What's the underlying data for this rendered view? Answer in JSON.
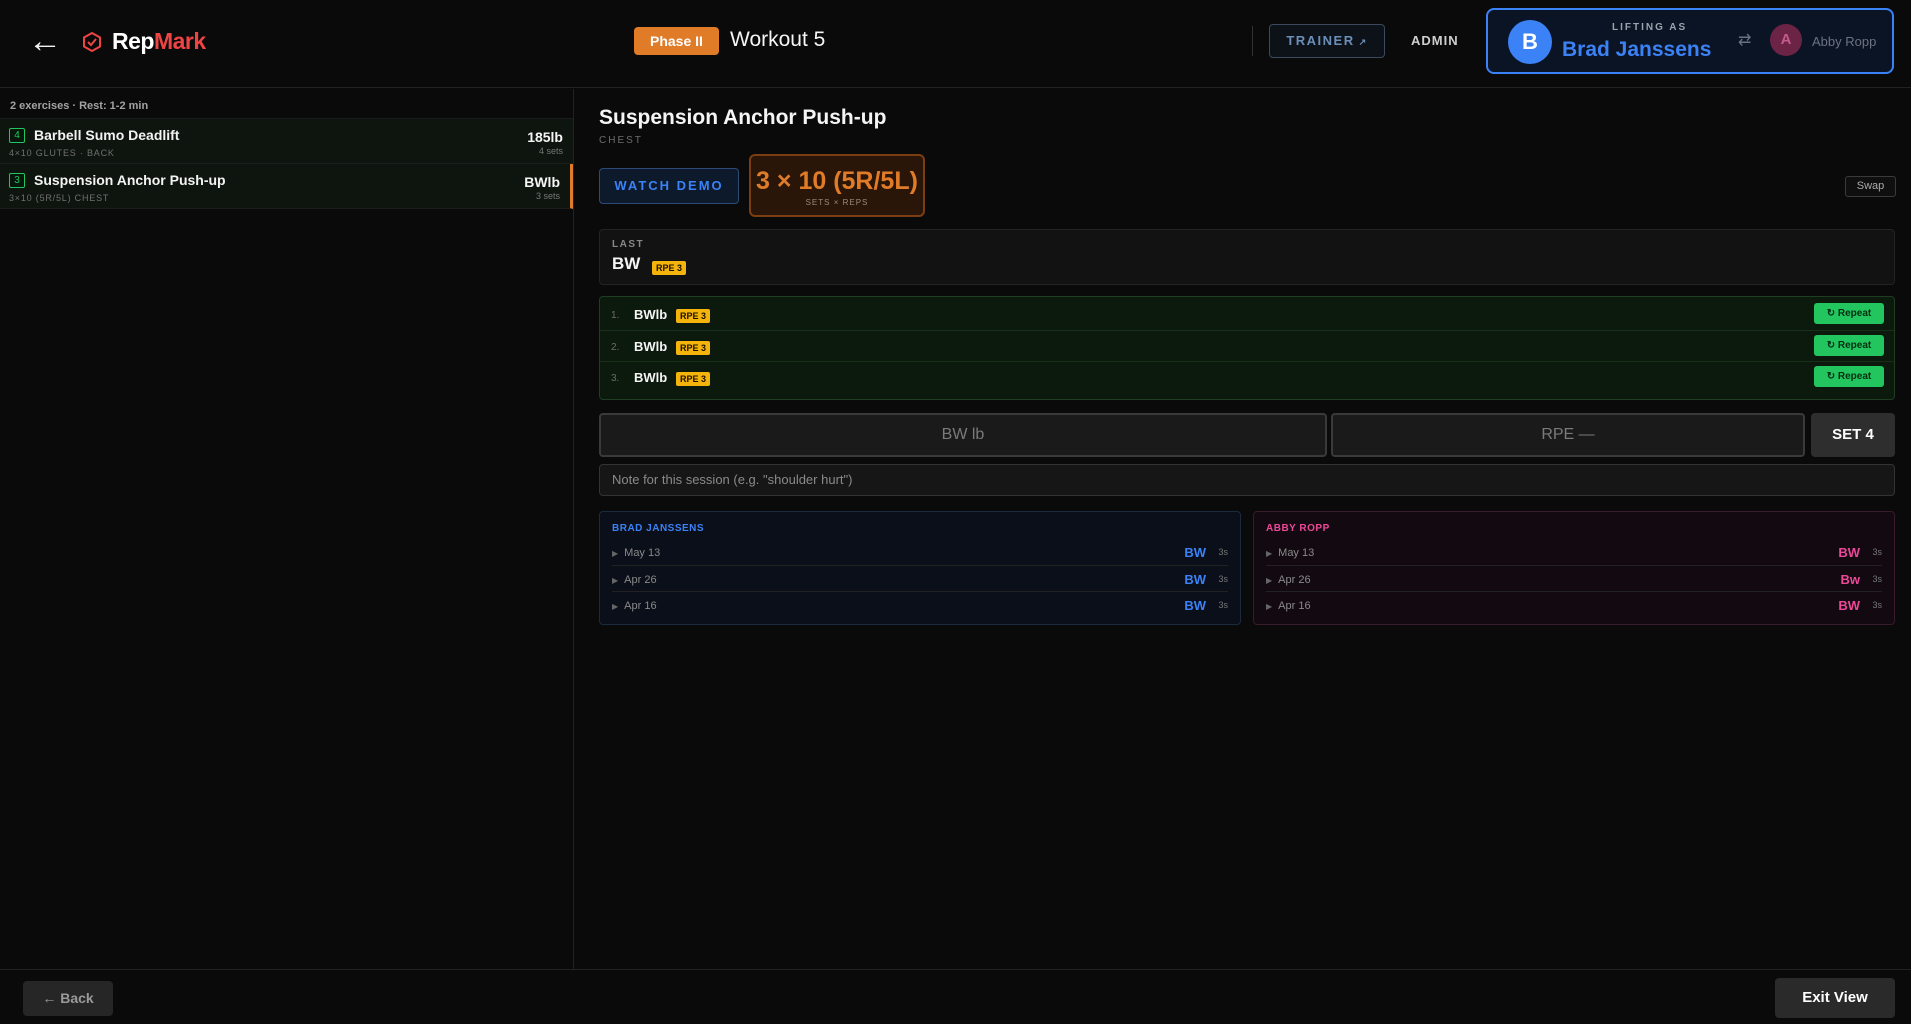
{
  "header": {
    "back_icon": "←",
    "brand_rep": "Rep",
    "brand_mark": "Mark",
    "phase": "Phase II",
    "workout": "Workout 5",
    "trainer": "TRAINER",
    "trainer_ext": "↗",
    "admin": "ADMIN",
    "lifting_as_label": "LIFTING AS",
    "current_initial": "B",
    "current_name": "Brad Janssens",
    "swap_icon": "⇄",
    "alt_initial": "A",
    "alt_name": "Abby Ropp"
  },
  "sidebar": {
    "summary": "2 exercises · Rest: 1-2 min",
    "items": [
      {
        "num": "4",
        "name": "Barbell Sumo Deadlift",
        "sub": "4×10  GLUTES · BACK",
        "weight": "185lb",
        "sets": "4 sets"
      },
      {
        "num": "3",
        "name": "Suspension Anchor Push-up",
        "sub": "3×10 (5R/5L)  CHEST",
        "weight": "BWlb",
        "sets": "3 sets"
      }
    ]
  },
  "exercise": {
    "title": "Suspension Anchor Push-up",
    "category": "CHEST",
    "watch_demo": "WATCH DEMO",
    "scheme": "3 × 10 (5R/5L)",
    "scheme_label": "SETS × REPS",
    "swap": "Swap",
    "last_label": "LAST",
    "last_value": "BW",
    "last_rpe": "RPE 3",
    "sets": [
      {
        "idx": "1.",
        "value": "BWlb",
        "rpe": "RPE 3",
        "action": "↻ Repeat"
      },
      {
        "idx": "2.",
        "value": "BWlb",
        "rpe": "RPE 3",
        "action": "↻ Repeat"
      },
      {
        "idx": "3.",
        "value": "BWlb",
        "rpe": "RPE 3",
        "action": "↻ Repeat"
      }
    ],
    "weight_placeholder": "BW lb",
    "rpe_placeholder": "RPE —",
    "set_button": "SET 4",
    "note_placeholder": "Note for this session (e.g. \"shoulder hurt\")"
  },
  "history": {
    "brad": {
      "title": "BRAD JANSSENS",
      "rows": [
        {
          "date": "May 13",
          "weight": "BW",
          "sets": "3s"
        },
        {
          "date": "Apr 26",
          "weight": "BW",
          "sets": "3s"
        },
        {
          "date": "Apr 16",
          "weight": "BW",
          "sets": "3s"
        }
      ]
    },
    "abby": {
      "title": "ABBY ROPP",
      "rows": [
        {
          "date": "May 13",
          "weight": "BW",
          "sets": "3s"
        },
        {
          "date": "Apr 26",
          "weight": "Bw",
          "sets": "3s"
        },
        {
          "date": "Apr 16",
          "weight": "BW",
          "sets": "3s"
        }
      ]
    }
  },
  "footer": {
    "back": "← Back",
    "exit": "Exit View"
  },
  "colors": {
    "accent_orange": "#e07b28",
    "brand_red": "#ef4444",
    "brad_blue": "#3b82f6",
    "abby_pink": "#ec4899",
    "repeat_green": "#22c55e",
    "rpe_yellow": "#f5b40b"
  }
}
